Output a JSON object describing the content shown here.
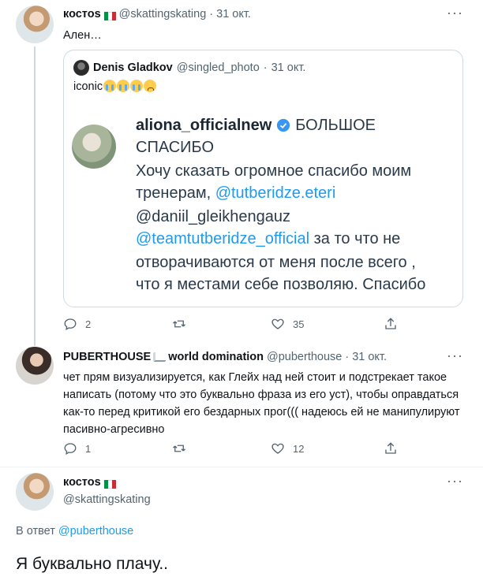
{
  "tweet1": {
    "author": "костоs",
    "handle": "@skattingskating",
    "date": "31 окт.",
    "text": "Ален…",
    "replies": "2",
    "likes": "35",
    "quote": {
      "author": "Denis Gladkov",
      "handle": "@singled_photo",
      "date": "31 окт.",
      "text": "iconic",
      "image": {
        "username": "aliona_officialnew",
        "headline_1": "БОЛЬШОЕ",
        "headline_2": "СПАСИБО",
        "line_1": "Хочу сказать огромное спасибо моим",
        "line_2_prefix": "тренерам, ",
        "mention_1": "@tutberidze.eteri",
        "mention_2": "@daniil_gleikhengauz",
        "mention_3": "@teamtutberidze_official",
        "line_5_suffix": " за то что не",
        "line_6": "отворачиваются от меня после всего ,",
        "line_7": "что я местами себе позволяю. Спасибо"
      }
    }
  },
  "tweet2": {
    "author": "PUBERTHOUSE",
    "author_suffix": "world domination",
    "handle": "@puberthouse",
    "date": "31 окт.",
    "text": "чет прям визуализируется, как Глейх над ней стоит и подстрекает такое написать (потому что это буквально фраза из его уст), чтобы оправдаться как-то перед критикой его бездарных прог((( надеюсь ей не манипулируют пасивно-агресивно",
    "replies": "1",
    "likes": "12"
  },
  "tweet3": {
    "author": "костоs",
    "handle": "@skattingskating",
    "reply_prefix": "В ответ ",
    "reply_to": "@puberthouse",
    "text": "Я буквально плачу.."
  },
  "colors": {
    "accent": "#1d9bf0",
    "muted": "#536471",
    "border": "#cfd9de",
    "verified": "#1d9bf0"
  }
}
